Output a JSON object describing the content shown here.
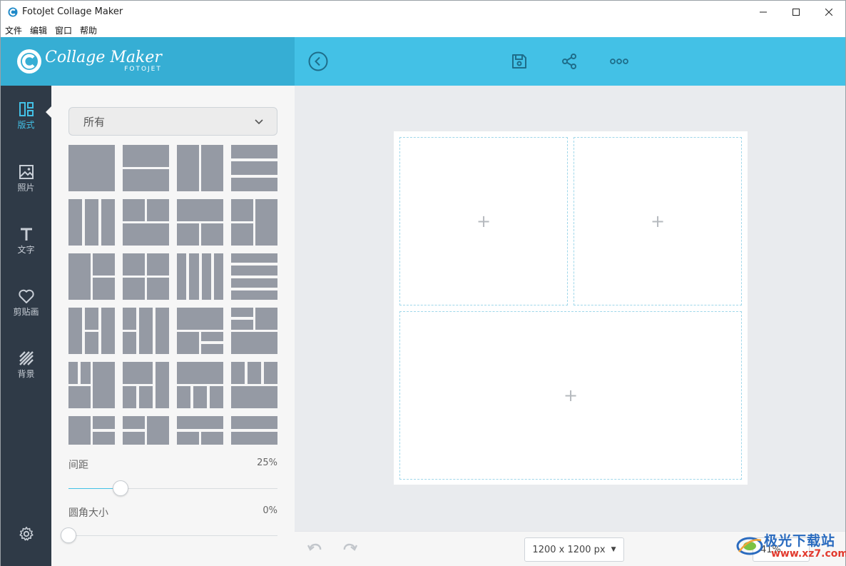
{
  "window": {
    "title": "FotoJet Collage Maker",
    "minimize": "—",
    "maximize": "☐",
    "close": "✕"
  },
  "menu": [
    "文件",
    "编辑",
    "窗口",
    "帮助"
  ],
  "brand": {
    "name": "Collage Maker",
    "sub": "FOTOJET"
  },
  "toolbar": {
    "back_icon": "back-circle-icon",
    "save_icon": "save-icon",
    "share_icon": "share-icon",
    "more_icon": "more-icon"
  },
  "nav": [
    {
      "label": "版式",
      "icon": "layout-icon",
      "active": true
    },
    {
      "label": "照片",
      "icon": "photo-icon",
      "active": false
    },
    {
      "label": "文字",
      "icon": "text-icon",
      "active": false
    },
    {
      "label": "剪贴画",
      "icon": "heart-icon",
      "active": false
    },
    {
      "label": "背景",
      "icon": "background-icon",
      "active": false
    }
  ],
  "panel": {
    "filter_value": "所有",
    "spacing": {
      "label": "间距",
      "value": "25%",
      "fraction": 0.25
    },
    "corner": {
      "label": "圆角大小",
      "value": "0%",
      "fraction": 0.0
    }
  },
  "canvas": {
    "cells": [
      "+",
      "+",
      "+"
    ]
  },
  "bottom": {
    "size_label": "1200 x 1200 px",
    "zoom_label": "41%"
  },
  "watermark": {
    "title": "极光下载站",
    "url": "www.xz7.com"
  }
}
